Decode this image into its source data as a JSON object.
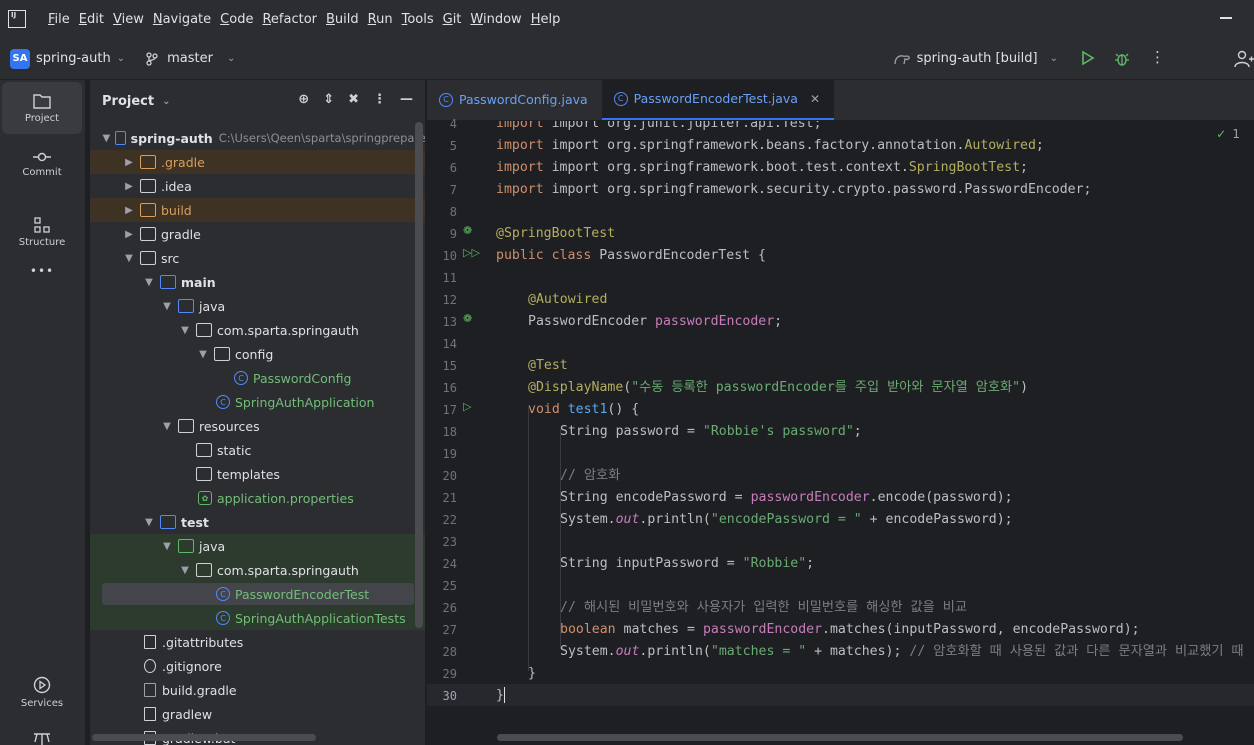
{
  "menu": {
    "items": [
      {
        "u": "F",
        "rest": "ile"
      },
      {
        "u": "E",
        "rest": "dit"
      },
      {
        "u": "V",
        "rest": "iew"
      },
      {
        "u": "N",
        "rest": "avigate"
      },
      {
        "u": "C",
        "rest": "ode"
      },
      {
        "u": "R",
        "rest": "efactor"
      },
      {
        "u": "B",
        "rest": "uild"
      },
      {
        "u": "R",
        "rest": "un"
      },
      {
        "u": "T",
        "rest": "ools"
      },
      {
        "u": "G",
        "rest": "it"
      },
      {
        "u": "W",
        "rest": "indow"
      },
      {
        "u": "H",
        "rest": "elp"
      }
    ]
  },
  "toolbar": {
    "project_badge": "SA",
    "project_name": "spring-auth",
    "branch": "master",
    "run_config": "spring-auth [build]"
  },
  "left_strip": {
    "project": "Project",
    "commit": "Commit",
    "structure": "Structure",
    "more": "•••",
    "services": "Services"
  },
  "project_panel": {
    "title": "Project",
    "root": {
      "name": "spring-auth",
      "path": "C:\\Users\\Qeen\\sparta\\springprepare"
    },
    "nodes": [
      {
        "label": ".gradle"
      },
      {
        "label": ".idea"
      },
      {
        "label": "build"
      },
      {
        "label": "gradle"
      },
      {
        "label": "src"
      },
      {
        "label": "main"
      },
      {
        "label": "java"
      },
      {
        "label": "com.sparta.springauth"
      },
      {
        "label": "config"
      },
      {
        "label": "PasswordConfig"
      },
      {
        "label": "SpringAuthApplication"
      },
      {
        "label": "resources"
      },
      {
        "label": "static"
      },
      {
        "label": "templates"
      },
      {
        "label": "application.properties"
      },
      {
        "label": "test"
      },
      {
        "label": "java"
      },
      {
        "label": "com.sparta.springauth"
      },
      {
        "label": "PasswordEncoderTest"
      },
      {
        "label": "SpringAuthApplicationTests"
      },
      {
        "label": ".gitattributes"
      },
      {
        "label": ".gitignore"
      },
      {
        "label": "build.gradle"
      },
      {
        "label": "gradlew"
      },
      {
        "label": "gradlew.bat"
      }
    ]
  },
  "editor": {
    "tabs": [
      {
        "label": "PasswordConfig.java"
      },
      {
        "label": "PasswordEncoderTest.java"
      }
    ],
    "inspection_count": "1",
    "line_numbers": [
      "4",
      "5",
      "6",
      "7",
      "8",
      "9",
      "10",
      "11",
      "12",
      "13",
      "14",
      "15",
      "16",
      "17",
      "18",
      "19",
      "20",
      "21",
      "22",
      "23",
      "24",
      "25",
      "26",
      "27",
      "28",
      "29",
      "30"
    ],
    "code": {
      "l4": "import org.junit.jupiter.api.Test;",
      "l5a": "import org.springframework.beans.factory.annotation.",
      "l5b": "Autowired",
      "l5c": ";",
      "l6a": "import org.springframework.boot.test.context.",
      "l6b": "SpringBootTest",
      "l6c": ";",
      "l7": "import org.springframework.security.crypto.password.PasswordEncoder;",
      "l9": "@SpringBootTest",
      "l10a": "public class ",
      "l10b": "PasswordEncoderTest {",
      "l12": "@Autowired",
      "l13a": "PasswordEncoder ",
      "l13b": "passwordEncoder",
      "l13c": ";",
      "l15": "@Test",
      "l16a": "@DisplayName",
      "l16b": "(",
      "l16c": "\"수동 등록한 passwordEncoder를 주입 받아와 문자열 암호화\"",
      "l16d": ")",
      "l17a": "void ",
      "l17b": "test1",
      "l17c": "() {",
      "l18a": "String password = ",
      "l18b": "\"Robbie's password\"",
      "l18c": ";",
      "l20": "// 암호화",
      "l21a": "String encodePassword = ",
      "l21b": "passwordEncoder",
      "l21c": ".encode(password);",
      "l22a": "System.",
      "l22b": "out",
      "l22c": ".println(",
      "l22d": "\"encodePassword = \"",
      "l22e": " + encodePassword);",
      "l24a": "String inputPassword = ",
      "l24b": "\"Robbie\"",
      "l24c": ";",
      "l26": "// 해시된 비밀번호와 사용자가 입력한 비밀번호를 해싱한 값을 비교",
      "l27a": "boolean ",
      "l27b": "matches = ",
      "l27c": "passwordEncoder",
      "l27d": ".matches(inputPassword, encodePassword);",
      "l28a": "System.",
      "l28b": "out",
      "l28c": ".println(",
      "l28d": "\"matches = \"",
      "l28e": " + matches); ",
      "l28f": "// 암호화할 때 사용된 값과 다른 문자열과 비교했기 때",
      "l29": "}",
      "l30": "}"
    }
  }
}
